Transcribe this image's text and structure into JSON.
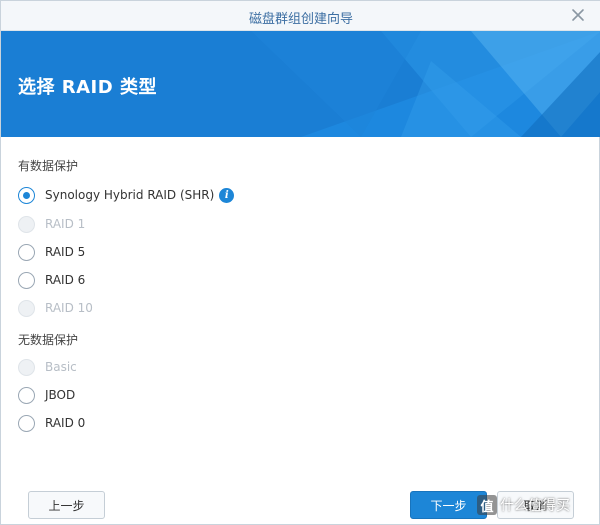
{
  "window": {
    "title": "磁盘群组创建向导"
  },
  "banner": {
    "heading": "选择 RAID 类型",
    "color": "#1a7ed4"
  },
  "groups": [
    {
      "label": "有数据保护",
      "options": [
        {
          "label": "Synology Hybrid RAID (SHR)",
          "state": "checked",
          "has_info_icon": true
        },
        {
          "label": "RAID 1",
          "state": "disabled"
        },
        {
          "label": "RAID 5",
          "state": "enabled"
        },
        {
          "label": "RAID 6",
          "state": "enabled"
        },
        {
          "label": "RAID 10",
          "state": "disabled"
        }
      ]
    },
    {
      "label": "无数据保护",
      "options": [
        {
          "label": "Basic",
          "state": "disabled"
        },
        {
          "label": "JBOD",
          "state": "enabled"
        },
        {
          "label": "RAID 0",
          "state": "enabled"
        }
      ]
    }
  ],
  "footer": {
    "back_label": "上一步",
    "next_label": "下一步",
    "cancel_label": "取消"
  },
  "watermark": {
    "text": "什么值得买",
    "logo_char": "值"
  },
  "colors": {
    "accent": "#1d86d7",
    "title_text": "#3d6fa3"
  }
}
